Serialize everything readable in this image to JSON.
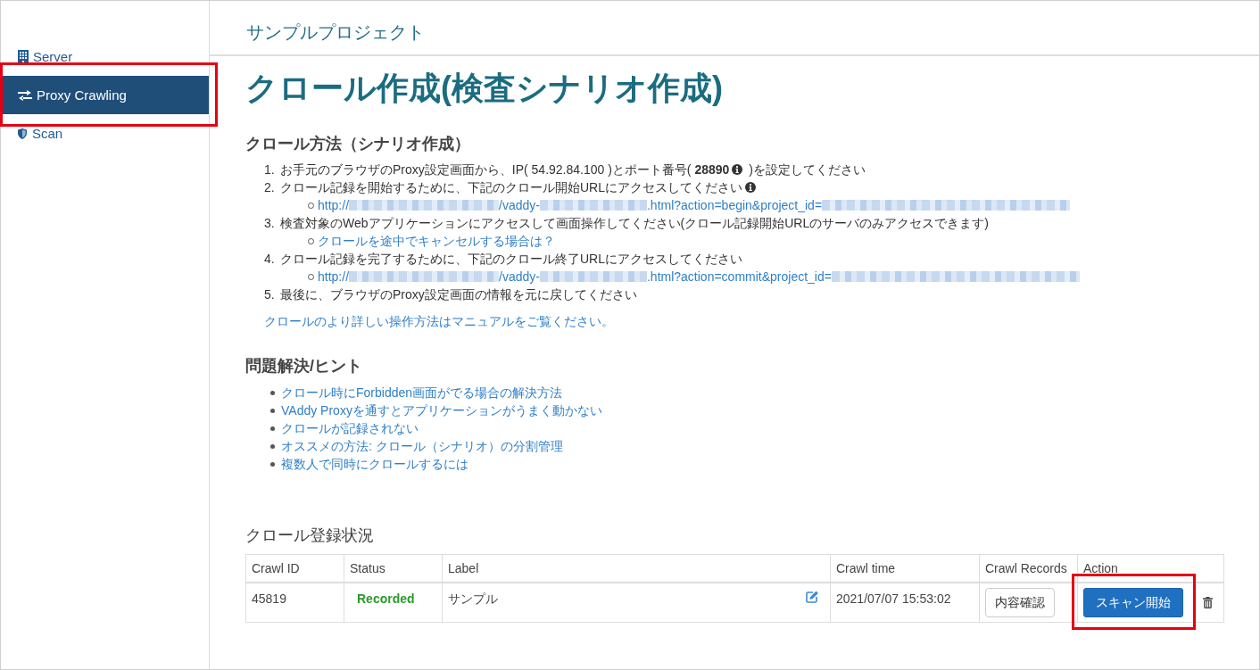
{
  "header": {
    "project_name": "サンプルプロジェクト"
  },
  "sidebar": {
    "items": [
      {
        "kind": "server",
        "label": "Server",
        "selected": false,
        "highlighted": false
      },
      {
        "kind": "proxy",
        "label": "Proxy Crawling",
        "selected": true,
        "highlighted": true
      },
      {
        "kind": "scan",
        "label": "Scan",
        "selected": false,
        "highlighted": false
      }
    ]
  },
  "page_title": "クロール作成(検査シナリオ作成)",
  "method_section": {
    "heading": "クロール方法（シナリオ作成）",
    "steps": [
      {
        "number": "1.",
        "text": "お手元のブラウザのProxy設定画面から、IP( 54.92.84.100 )とポート番号( **28890**",
        "info_icon": true,
        "text_after": " )を設定してください"
      },
      {
        "number": "2.",
        "text": "クロール記録を開始するために、下記のクロール開始URLにアクセスしてください",
        "info_icon": true,
        "links": [
          {
            "segments": [
              {
                "kind": "text",
                "text": "http://"
              },
              {
                "kind": "redacted"
              },
              {
                "kind": "text",
                "text": "/vaddy-"
              },
              {
                "kind": "redacted"
              },
              {
                "kind": "text",
                "text": ".html?action=begin&project_id="
              },
              {
                "kind": "redacted"
              }
            ]
          }
        ]
      },
      {
        "number": "3.",
        "text": "検査対象のWebアプリケーションにアクセスして画面操作してください(クロール記録開始URLのサーバのみアクセスできます)",
        "info_icon": false,
        "links": [
          {
            "segments": [
              {
                "kind": "text",
                "text": "クロールを途中でキャンセルする場合は？"
              }
            ]
          }
        ]
      },
      {
        "number": "4.",
        "text": "クロール記録を完了するために、下記のクロール終了URLにアクセスしてください",
        "info_icon": false,
        "links": [
          {
            "segments": [
              {
                "kind": "text",
                "text": "http://"
              },
              {
                "kind": "redacted"
              },
              {
                "kind": "text",
                "text": "/vaddy-"
              },
              {
                "kind": "redacted"
              },
              {
                "kind": "text",
                "text": ".html?action=commit&project_id="
              },
              {
                "kind": "redacted"
              }
            ]
          }
        ]
      },
      {
        "number": "5.",
        "text": "最後に、ブラウザのProxy設定画面の情報を元に戻してください",
        "info_icon": false
      }
    ],
    "manual_link": "クロールのより詳しい操作方法はマニュアルをご覧ください。"
  },
  "hints_section": {
    "heading": "問題解決/ヒント",
    "links": [
      "クロール時にForbidden画面がでる場合の解決方法",
      "VAddy Proxyを通すとアプリケーションがうまく動かない",
      "クロールが記録されない",
      "オススメの方法: クロール（シナリオ）の分割管理",
      "複数人で同時にクロールするには"
    ]
  },
  "crawl_status": {
    "heading": "クロール登録状況",
    "table": {
      "columns": [
        "Crawl ID",
        "Status",
        "Label",
        "Crawl time",
        "Crawl Records",
        "Action"
      ],
      "rows": [
        {
          "crawl_id": "45819",
          "status": {
            "text": "Recorded",
            "kind": "recorded"
          },
          "label": "サンプル",
          "crawl_time": "2021/07/07 15:53:02",
          "records_button": "内容確認",
          "action_button": {
            "label": "スキャン開始",
            "highlighted": true
          }
        }
      ]
    }
  }
}
